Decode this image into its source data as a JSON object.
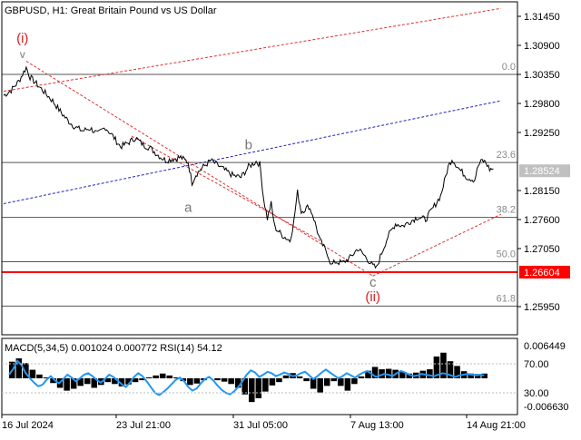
{
  "header": {
    "title": "GBPUSD, H1:  Great Britain Pound vs US Dollar"
  },
  "colors": {
    "background": "#ffffff",
    "price_line": "#000000",
    "axis_text": "#000000",
    "fib_line": "#555555",
    "fib_label": "#888888",
    "support_line": "#ff0000",
    "trend_channel_red": "#e03030",
    "trend_channel_blue": "#2020c0",
    "wave_label_red": "#d62020",
    "wave_label_gray": "#777777",
    "price_box_gray": "#c0c0c0",
    "price_box_red": "#ff0000",
    "macd_bar": "#000000",
    "rsi_line": "#2196f3"
  },
  "chart_data": [
    {
      "type": "line",
      "symbol": "GBPUSD",
      "timeframe": "H1",
      "title": "GBPUSD, H1:  Great Britain Pound vs US Dollar",
      "y_ticks": [
        "1.31450",
        "1.30900",
        "1.30350",
        "1.29800",
        "1.29250",
        "1.28150",
        "1.27600",
        "1.27050",
        "1.25950"
      ],
      "ylim": [
        1.2565,
        1.3175
      ],
      "x_ticks": [
        "16 Jul 2024",
        "23 Jul 21:00",
        "31 Jul 05:00",
        "7 Aug 13:00",
        "14 Aug 21:00"
      ],
      "current_price": "1.28524",
      "support_price": "1.26604",
      "support_level": 1.26604,
      "price_path": [
        [
          0,
          1.2995
        ],
        [
          2,
          1.3005
        ],
        [
          4,
          1.3022
        ],
        [
          6,
          1.3048
        ],
        [
          7,
          1.303
        ],
        [
          9,
          1.3015
        ],
        [
          11,
          1.3
        ],
        [
          13,
          1.2985
        ],
        [
          15,
          1.2965
        ],
        [
          17,
          1.2948
        ],
        [
          19,
          1.2935
        ],
        [
          21,
          1.2928
        ],
        [
          23,
          1.2933
        ],
        [
          25,
          1.2922
        ],
        [
          27,
          1.2935
        ],
        [
          29,
          1.2918
        ],
        [
          31,
          1.2898
        ],
        [
          33,
          1.2905
        ],
        [
          35,
          1.2915
        ],
        [
          37,
          1.2902
        ],
        [
          39,
          1.2895
        ],
        [
          41,
          1.2882
        ],
        [
          43,
          1.2872
        ],
        [
          45,
          1.2875
        ],
        [
          47,
          1.2878
        ],
        [
          49,
          1.2868
        ],
        [
          50,
          1.283
        ],
        [
          51,
          1.2845
        ],
        [
          53,
          1.286
        ],
        [
          55,
          1.2872
        ],
        [
          57,
          1.2862
        ],
        [
          59,
          1.2852
        ],
        [
          61,
          1.2843
        ],
        [
          63,
          1.284
        ],
        [
          65,
          1.286
        ],
        [
          67,
          1.287
        ],
        [
          68,
          1.2865
        ],
        [
          69,
          1.28
        ],
        [
          70,
          1.2762
        ],
        [
          71,
          1.279
        ],
        [
          72,
          1.2745
        ],
        [
          74,
          1.273
        ],
        [
          76,
          1.272
        ],
        [
          77,
          1.2755
        ],
        [
          78,
          1.2812
        ],
        [
          79,
          1.2775
        ],
        [
          81,
          1.2785
        ],
        [
          82,
          1.277
        ],
        [
          84,
          1.272
        ],
        [
          86,
          1.2695
        ],
        [
          87,
          1.2673
        ],
        [
          88,
          1.268
        ],
        [
          90,
          1.2678
        ],
        [
          92,
          1.2688
        ],
        [
          94,
          1.2705
        ],
        [
          96,
          1.269
        ],
        [
          98,
          1.2672
        ],
        [
          99,
          1.2668
        ],
        [
          100,
          1.269
        ],
        [
          102,
          1.2728
        ],
        [
          104,
          1.2752
        ],
        [
          106,
          1.2748
        ],
        [
          108,
          1.2757
        ],
        [
          110,
          1.2765
        ],
        [
          112,
          1.276
        ],
        [
          114,
          1.2782
        ],
        [
          116,
          1.2805
        ],
        [
          118,
          1.286
        ],
        [
          119,
          1.2875
        ],
        [
          121,
          1.2855
        ],
        [
          123,
          1.284
        ],
        [
          125,
          1.2835
        ],
        [
          126,
          1.2862
        ],
        [
          127,
          1.2872
        ],
        [
          128,
          1.2868
        ],
        [
          129,
          1.2855
        ],
        [
          130,
          1.2856
        ]
      ],
      "fib_levels": [
        {
          "label": "0.0",
          "price": 1.3035
        },
        {
          "label": "23.6",
          "price": 1.2868
        },
        {
          "label": "38.2",
          "price": 1.2764
        },
        {
          "label": "50.0",
          "price": 1.268
        },
        {
          "label": "61.8",
          "price": 1.2596
        }
      ],
      "trend_lines": [
        {
          "color": "red",
          "from": [
            0,
            1.3003
          ],
          "to": [
            132,
            1.316
          ]
        },
        {
          "color": "blue",
          "from": [
            0,
            1.279
          ],
          "to": [
            132,
            1.2985
          ]
        },
        {
          "color": "red",
          "from": [
            6,
            1.306
          ],
          "to": [
            98,
            1.2653
          ]
        },
        {
          "color": "red",
          "from": [
            98,
            1.2653
          ],
          "to": [
            132,
            1.277
          ]
        },
        {
          "color": "red",
          "from": [
            34,
            1.2918
          ],
          "to": [
            84,
            1.272
          ]
        }
      ],
      "wave_labels": [
        {
          "text": "(i)",
          "at": [
            5,
            1.3095
          ],
          "color": "red"
        },
        {
          "text": "a",
          "at": [
            49,
            1.2775
          ],
          "color": "gray"
        },
        {
          "text": "b",
          "at": [
            65,
            1.2893
          ],
          "color": "gray"
        },
        {
          "text": "c",
          "at": [
            98,
            1.2633
          ],
          "color": "gray"
        },
        {
          "text": "(ii)",
          "at": [
            98,
            1.2605
          ],
          "color": "red"
        }
      ]
    },
    {
      "type": "line",
      "title": "MACD(5,34,5) 0.001024 0.000772 RSI(14) 54.12",
      "indicators": "MACD(5,34,5) 0.001024 0.000772 RSI(14) 54.12",
      "macd": {
        "params": [
          5,
          34,
          5
        ],
        "main": 0.001024,
        "signal": 0.000772,
        "max_label": "0.006449",
        "min_label": "-0.006630"
      },
      "rsi": {
        "period": 14,
        "value": 54.12,
        "level_labels": [
          "70.00",
          "30.00"
        ]
      },
      "ylim": [
        -0.00663,
        0.006449
      ],
      "macd_values": [
        0.0035,
        0.0042,
        0.0032,
        0.0018,
        0.0008,
        0.0002,
        -0.001,
        -0.002,
        -0.0026,
        -0.0022,
        -0.0016,
        -0.0012,
        -0.002,
        -0.0014,
        -0.0008,
        -0.0012,
        -0.0017,
        -0.0013,
        -0.0008,
        -0.0004,
        0.0002,
        0.0006,
        0.001,
        0.0006,
        0.0002,
        -0.0006,
        -0.0014,
        -0.0011,
        -0.0004,
        0.0,
        -0.0004,
        -0.0007,
        -0.0012,
        -0.002,
        -0.0034,
        -0.005,
        -0.0042,
        -0.0028,
        -0.0015,
        -0.0008,
        0.0006,
        0.0011,
        0.0004,
        -0.0006,
        -0.0022,
        -0.003,
        -0.0016,
        -0.0006,
        -0.0016,
        -0.0026,
        -0.0012,
        0.0004,
        0.0016,
        0.0024,
        0.0019,
        0.002,
        0.0018,
        0.0014,
        0.001,
        0.0012,
        0.0016,
        0.0019,
        0.0046,
        0.0054,
        0.0036,
        0.0026,
        0.0015,
        0.001,
        0.0009,
        0.001
      ],
      "rsi_values": [
        55,
        63,
        74,
        68,
        57,
        50,
        44,
        39,
        41,
        48,
        53,
        47,
        43,
        49,
        55,
        51,
        46,
        50,
        55,
        57,
        53,
        48,
        44,
        49,
        55,
        52,
        47,
        42,
        38,
        44,
        52,
        57,
        53,
        46,
        38,
        30,
        27,
        31,
        36,
        42,
        48,
        51,
        46,
        38,
        33,
        36,
        43,
        49,
        52,
        47,
        40,
        34,
        30,
        28,
        32,
        38,
        46,
        55,
        61,
        58,
        52,
        55,
        59,
        57,
        53,
        55,
        58,
        56,
        53,
        54,
        57,
        59,
        54,
        49,
        53,
        58,
        62,
        58,
        54,
        50,
        53,
        57,
        54,
        51,
        55,
        58,
        60,
        56,
        52,
        54,
        56,
        55,
        53,
        57,
        60,
        58,
        55,
        53,
        54,
        56,
        55,
        54,
        53,
        55,
        57,
        56,
        54,
        52,
        54,
        55,
        56,
        55,
        54,
        55,
        54
      ]
    }
  ]
}
